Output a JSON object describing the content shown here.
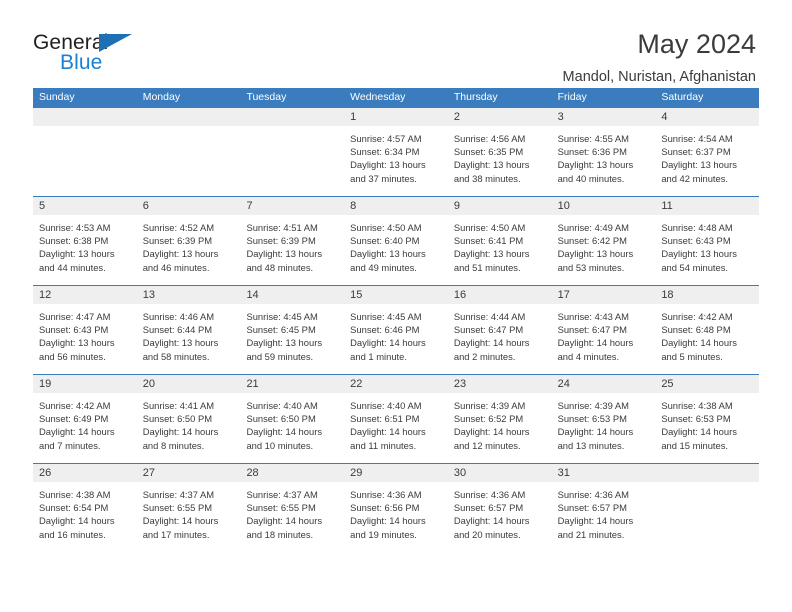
{
  "brand": {
    "name_top": "General",
    "name_bottom": "Blue",
    "accent_color": "#1b7fd4",
    "triangle_color": "#1f6fb5"
  },
  "header": {
    "title": "May 2024",
    "subtitle": "Mandol, Nuristan, Afghanistan"
  },
  "calendar": {
    "header_bg": "#3a7cbe",
    "day_band_bg": "#efefef",
    "weekdays": [
      "Sunday",
      "Monday",
      "Tuesday",
      "Wednesday",
      "Thursday",
      "Friday",
      "Saturday"
    ],
    "weeks": [
      [
        {
          "day": "",
          "lines": []
        },
        {
          "day": "",
          "lines": []
        },
        {
          "day": "",
          "lines": []
        },
        {
          "day": "1",
          "lines": [
            "Sunrise: 4:57 AM",
            "Sunset: 6:34 PM",
            "Daylight: 13 hours",
            "and 37 minutes."
          ]
        },
        {
          "day": "2",
          "lines": [
            "Sunrise: 4:56 AM",
            "Sunset: 6:35 PM",
            "Daylight: 13 hours",
            "and 38 minutes."
          ]
        },
        {
          "day": "3",
          "lines": [
            "Sunrise: 4:55 AM",
            "Sunset: 6:36 PM",
            "Daylight: 13 hours",
            "and 40 minutes."
          ]
        },
        {
          "day": "4",
          "lines": [
            "Sunrise: 4:54 AM",
            "Sunset: 6:37 PM",
            "Daylight: 13 hours",
            "and 42 minutes."
          ]
        }
      ],
      [
        {
          "day": "5",
          "lines": [
            "Sunrise: 4:53 AM",
            "Sunset: 6:38 PM",
            "Daylight: 13 hours",
            "and 44 minutes."
          ]
        },
        {
          "day": "6",
          "lines": [
            "Sunrise: 4:52 AM",
            "Sunset: 6:39 PM",
            "Daylight: 13 hours",
            "and 46 minutes."
          ]
        },
        {
          "day": "7",
          "lines": [
            "Sunrise: 4:51 AM",
            "Sunset: 6:39 PM",
            "Daylight: 13 hours",
            "and 48 minutes."
          ]
        },
        {
          "day": "8",
          "lines": [
            "Sunrise: 4:50 AM",
            "Sunset: 6:40 PM",
            "Daylight: 13 hours",
            "and 49 minutes."
          ]
        },
        {
          "day": "9",
          "lines": [
            "Sunrise: 4:50 AM",
            "Sunset: 6:41 PM",
            "Daylight: 13 hours",
            "and 51 minutes."
          ]
        },
        {
          "day": "10",
          "lines": [
            "Sunrise: 4:49 AM",
            "Sunset: 6:42 PM",
            "Daylight: 13 hours",
            "and 53 minutes."
          ]
        },
        {
          "day": "11",
          "lines": [
            "Sunrise: 4:48 AM",
            "Sunset: 6:43 PM",
            "Daylight: 13 hours",
            "and 54 minutes."
          ]
        }
      ],
      [
        {
          "day": "12",
          "lines": [
            "Sunrise: 4:47 AM",
            "Sunset: 6:43 PM",
            "Daylight: 13 hours",
            "and 56 minutes."
          ]
        },
        {
          "day": "13",
          "lines": [
            "Sunrise: 4:46 AM",
            "Sunset: 6:44 PM",
            "Daylight: 13 hours",
            "and 58 minutes."
          ]
        },
        {
          "day": "14",
          "lines": [
            "Sunrise: 4:45 AM",
            "Sunset: 6:45 PM",
            "Daylight: 13 hours",
            "and 59 minutes."
          ]
        },
        {
          "day": "15",
          "lines": [
            "Sunrise: 4:45 AM",
            "Sunset: 6:46 PM",
            "Daylight: 14 hours",
            "and 1 minute."
          ]
        },
        {
          "day": "16",
          "lines": [
            "Sunrise: 4:44 AM",
            "Sunset: 6:47 PM",
            "Daylight: 14 hours",
            "and 2 minutes."
          ]
        },
        {
          "day": "17",
          "lines": [
            "Sunrise: 4:43 AM",
            "Sunset: 6:47 PM",
            "Daylight: 14 hours",
            "and 4 minutes."
          ]
        },
        {
          "day": "18",
          "lines": [
            "Sunrise: 4:42 AM",
            "Sunset: 6:48 PM",
            "Daylight: 14 hours",
            "and 5 minutes."
          ]
        }
      ],
      [
        {
          "day": "19",
          "lines": [
            "Sunrise: 4:42 AM",
            "Sunset: 6:49 PM",
            "Daylight: 14 hours",
            "and 7 minutes."
          ]
        },
        {
          "day": "20",
          "lines": [
            "Sunrise: 4:41 AM",
            "Sunset: 6:50 PM",
            "Daylight: 14 hours",
            "and 8 minutes."
          ]
        },
        {
          "day": "21",
          "lines": [
            "Sunrise: 4:40 AM",
            "Sunset: 6:50 PM",
            "Daylight: 14 hours",
            "and 10 minutes."
          ]
        },
        {
          "day": "22",
          "lines": [
            "Sunrise: 4:40 AM",
            "Sunset: 6:51 PM",
            "Daylight: 14 hours",
            "and 11 minutes."
          ]
        },
        {
          "day": "23",
          "lines": [
            "Sunrise: 4:39 AM",
            "Sunset: 6:52 PM",
            "Daylight: 14 hours",
            "and 12 minutes."
          ]
        },
        {
          "day": "24",
          "lines": [
            "Sunrise: 4:39 AM",
            "Sunset: 6:53 PM",
            "Daylight: 14 hours",
            "and 13 minutes."
          ]
        },
        {
          "day": "25",
          "lines": [
            "Sunrise: 4:38 AM",
            "Sunset: 6:53 PM",
            "Daylight: 14 hours",
            "and 15 minutes."
          ]
        }
      ],
      [
        {
          "day": "26",
          "lines": [
            "Sunrise: 4:38 AM",
            "Sunset: 6:54 PM",
            "Daylight: 14 hours",
            "and 16 minutes."
          ]
        },
        {
          "day": "27",
          "lines": [
            "Sunrise: 4:37 AM",
            "Sunset: 6:55 PM",
            "Daylight: 14 hours",
            "and 17 minutes."
          ]
        },
        {
          "day": "28",
          "lines": [
            "Sunrise: 4:37 AM",
            "Sunset: 6:55 PM",
            "Daylight: 14 hours",
            "and 18 minutes."
          ]
        },
        {
          "day": "29",
          "lines": [
            "Sunrise: 4:36 AM",
            "Sunset: 6:56 PM",
            "Daylight: 14 hours",
            "and 19 minutes."
          ]
        },
        {
          "day": "30",
          "lines": [
            "Sunrise: 4:36 AM",
            "Sunset: 6:57 PM",
            "Daylight: 14 hours",
            "and 20 minutes."
          ]
        },
        {
          "day": "31",
          "lines": [
            "Sunrise: 4:36 AM",
            "Sunset: 6:57 PM",
            "Daylight: 14 hours",
            "and 21 minutes."
          ]
        },
        {
          "day": "",
          "lines": []
        }
      ]
    ]
  }
}
